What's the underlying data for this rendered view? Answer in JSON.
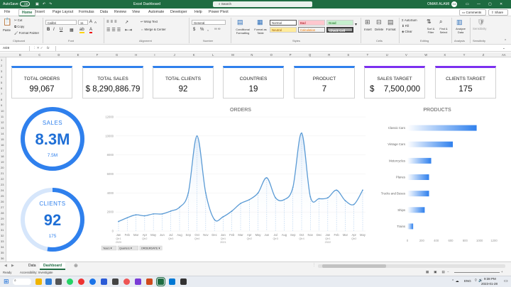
{
  "titlebar": {
    "autosave": "AutoSave",
    "autosave_state": "Off",
    "filename": "Excel Dashboard",
    "search_placeholder": "Search",
    "user": "OMAR ALAMI",
    "user_initials": "OA"
  },
  "ribbon_tabs": [
    "File",
    "Home",
    "Insert",
    "Page Layout",
    "Formulas",
    "Data",
    "Review",
    "View",
    "Automate",
    "Developer",
    "Help",
    "Power Pivot"
  ],
  "ribbon_active_tab": "Home",
  "ribbon_right": {
    "comments": "Comments",
    "share": "Share"
  },
  "ribbon": {
    "clipboard": {
      "paste": "Paste",
      "cut": "Cut",
      "copy": "Copy",
      "format_painter": "Format Painter",
      "label": "Clipboard"
    },
    "font": {
      "name": "Calibri",
      "size": "11",
      "label": "Font",
      "bold": "B",
      "italic": "I",
      "underline": "U",
      "grow": "A",
      "shrink": "A",
      "font_color": "A",
      "highlight": "ab"
    },
    "alignment": {
      "wrap": "Wrap Text",
      "merge": "Merge & Center",
      "label": "Alignment"
    },
    "number": {
      "format": "General",
      "label": "Number",
      "currency": "$",
      "percent": "%",
      "comma": ","
    },
    "styles": {
      "conditional": "Conditional Formatting",
      "format_table": "Format as Table",
      "normal": "Normal",
      "bad": "Bad",
      "good": "Good",
      "neutral": "Neutral",
      "calculation": "Calculation",
      "check_cell": "Check Cell",
      "label": "Styles"
    },
    "cells": {
      "insert": "Insert",
      "delete": "Delete",
      "format": "Format",
      "label": "Cells"
    },
    "editing": {
      "autosum": "AutoSum",
      "fill": "Fill",
      "clear": "Clear",
      "sort": "Sort & Filter",
      "find": "Find & Select",
      "label": "Editing"
    },
    "analysis": {
      "analyze": "Analyze Data",
      "label": "Analysis"
    },
    "sensitivity": {
      "label": "Sensitivity",
      "button": "Sensitivity"
    }
  },
  "formula_bar": {
    "name_box": "AG9",
    "fx": "fx",
    "formula": ""
  },
  "columns": [
    "B",
    "C",
    "D",
    "E",
    "F",
    "G",
    "H",
    "I",
    "J",
    "K",
    "L",
    "M",
    "N",
    "O",
    "P",
    "Q",
    "R",
    "S",
    "T",
    "U",
    "V",
    "W",
    "X",
    "Y",
    "Z",
    "AA"
  ],
  "rows": [
    "1",
    "2",
    "3",
    "4",
    "5",
    "6",
    "7",
    "8",
    "9",
    "10",
    "11",
    "12",
    "13",
    "14",
    "15",
    "16",
    "17",
    "18",
    "19",
    "20",
    "21",
    "22",
    "23",
    "24",
    "25",
    "26",
    "27",
    "28",
    "29",
    "30",
    "31",
    "32",
    "33",
    "34",
    "35",
    "36"
  ],
  "kpis": [
    {
      "label": "TOTAL ORDERS",
      "value": "99,067"
    },
    {
      "label": "TOTAL SALES",
      "value": "$ 8,290,886.79"
    },
    {
      "label": "TOTAL CLIENTS",
      "value": "92"
    },
    {
      "label": "COUNTRIES",
      "value": "19"
    },
    {
      "label": "PRODUCT",
      "value": "7"
    },
    {
      "label": "SALES TARGET",
      "value_symbol": "$",
      "value": "7,500,000"
    },
    {
      "label": "CLIENTS TARGET",
      "value": "175"
    }
  ],
  "sales_donut": {
    "title": "SALES",
    "value": "8.3M",
    "target": "7.5M",
    "percent": 100,
    "color": "#2f80ed"
  },
  "clients_donut": {
    "title": "CLIENTS",
    "value": "92",
    "target": "175",
    "percent": 52.6,
    "color": "#2f80ed"
  },
  "chart_data": [
    {
      "type": "line",
      "title": "ORDERS",
      "x": [
        "Jan",
        "Feb",
        "Mar",
        "Apr",
        "May",
        "Jun",
        "Jul",
        "Aug",
        "Sep",
        "Oct",
        "Nov",
        "Dec",
        "Jan",
        "Feb",
        "Mar",
        "Apr",
        "May",
        "Jun",
        "Jul",
        "Aug",
        "Sep",
        "Oct",
        "Nov",
        "Dec",
        "Jan",
        "Feb",
        "Mar",
        "Apr",
        "May"
      ],
      "group_labels": [
        {
          "index": 0,
          "label": "Qtr1",
          "sub": "2020"
        },
        {
          "index": 3,
          "label": "Qtr2"
        },
        {
          "index": 6,
          "label": "Qtr3"
        },
        {
          "index": 9,
          "label": "Qtr4"
        },
        {
          "index": 12,
          "label": "Qtr1",
          "sub": "2021"
        },
        {
          "index": 15,
          "label": "Qtr2"
        },
        {
          "index": 18,
          "label": "Qtr3"
        },
        {
          "index": 21,
          "label": "Qtr4"
        },
        {
          "index": 24,
          "label": "Qtr1",
          "sub": "2022"
        },
        {
          "index": 27,
          "label": "Qtr2"
        }
      ],
      "series": [
        {
          "values": [
            1000,
            1400,
            1700,
            1600,
            1800,
            1800,
            2100,
            2500,
            4000,
            10000,
            4000,
            1200,
            1500,
            2100,
            2900,
            3300,
            4000,
            5600,
            3500,
            3300,
            4600,
            10300,
            3600,
            3400,
            3500,
            4300,
            3200,
            2800,
            4300
          ]
        }
      ],
      "ylim": [
        0,
        12000
      ],
      "yticks": [
        0,
        2000,
        4000,
        6000,
        8000,
        10000,
        12000
      ],
      "grid": true,
      "color": "#5b9bd5",
      "field_buttons": [
        "Years",
        "Quarters",
        "ORDERDATE"
      ]
    },
    {
      "type": "bar",
      "orientation": "horizontal",
      "title": "PRODUCTS",
      "categories": [
        "Classic Cars",
        "Vintage Cars",
        "Motorcycles",
        "Planes",
        "Trucks and Buses",
        "Ships",
        "Trains"
      ],
      "values": [
        960,
        630,
        330,
        300,
        300,
        240,
        80
      ],
      "xlim": [
        0,
        1200
      ],
      "xticks": [
        0,
        200,
        400,
        600,
        800,
        1000,
        1200
      ],
      "color": "#2f80ed"
    }
  ],
  "sheet_tabs": [
    "Data",
    "Dashboard"
  ],
  "active_sheet": "Dashboard",
  "status": {
    "ready": "Ready",
    "accessibility": "Accessibility: Investigate"
  },
  "taskbar": {
    "time": "9:38 PM",
    "date": "2023-01-28",
    "lang": "ENG"
  }
}
